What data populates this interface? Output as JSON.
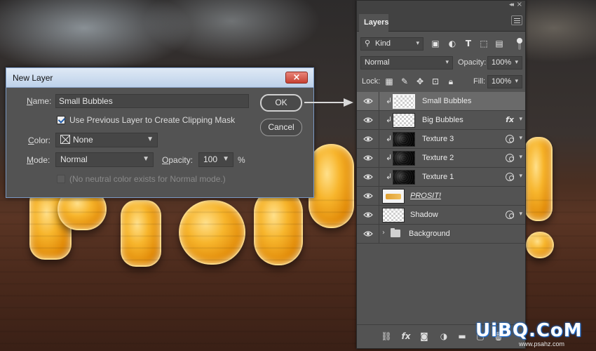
{
  "dialog": {
    "title": "New Layer",
    "close_glyph": "×",
    "name_label_pre": "",
    "name_label_u": "N",
    "name_label_post": "ame:",
    "name_value": "Small Bubbles",
    "clip_checkbox_checked": true,
    "clip_checkbox_label": "Use Previous Layer to Create Clipping Mask",
    "color_label_pre": "",
    "color_label_u": "C",
    "color_label_post": "olor:",
    "color_value": "None",
    "mode_label_pre": "",
    "mode_label_u": "M",
    "mode_label_post": "ode:",
    "mode_value": "Normal",
    "opacity_label_pre": "",
    "opacity_label_u": "O",
    "opacity_label_post": "pacity:",
    "opacity_value": "100",
    "opacity_unit": "%",
    "neutral_label": "(No neutral color exists for Normal mode.)",
    "ok_label": "OK",
    "cancel_label": "Cancel"
  },
  "panel": {
    "tab_label": "Layers",
    "filter_value": "Kind",
    "blend_mode": "Normal",
    "opacity_label": "Opacity:",
    "opacity_value": "100%",
    "lock_label": "Lock:",
    "fill_label": "Fill:",
    "fill_value": "100%",
    "layers": [
      {
        "name": "Small Bubbles",
        "clipped": true,
        "selected": true,
        "thumb": "checker-selected",
        "badge": "none"
      },
      {
        "name": "Big Bubbles",
        "clipped": true,
        "selected": false,
        "thumb": "checker",
        "badge": "fx"
      },
      {
        "name": "Texture 3",
        "clipped": true,
        "selected": false,
        "thumb": "dark",
        "badge": "smart"
      },
      {
        "name": "Texture 2",
        "clipped": true,
        "selected": false,
        "thumb": "dark",
        "badge": "smart"
      },
      {
        "name": "Texture 1",
        "clipped": true,
        "selected": false,
        "thumb": "dark",
        "badge": "smart"
      },
      {
        "name": "PROSIT!",
        "clipped": false,
        "selected": false,
        "thumb": "text",
        "badge": "none"
      },
      {
        "name": "Shadow",
        "clipped": false,
        "selected": false,
        "thumb": "shadow",
        "badge": "smart"
      },
      {
        "name": "Background",
        "clipped": false,
        "selected": false,
        "thumb": "folder",
        "badge": "none"
      }
    ]
  },
  "icons": {
    "eye": "eye-icon",
    "clip": "clipping-arrow-icon",
    "fx": "fx",
    "link": "link-icon",
    "mask": "mask-icon",
    "adjustment": "adjustment-icon",
    "folder": "folder-icon",
    "new_layer": "new-layer-icon",
    "trash": "trash-icon"
  },
  "watermark": {
    "main": "UiBQ.CoM",
    "sub": "www.psahz.com"
  },
  "colors": {
    "panel_bg": "#535353",
    "panel_dark": "#424242",
    "selected_row": "#6a6a6a",
    "dialog_title_bg": "#bdd1ea",
    "close_button": "#c74133",
    "watermark_outline": "#1b6fd8"
  }
}
